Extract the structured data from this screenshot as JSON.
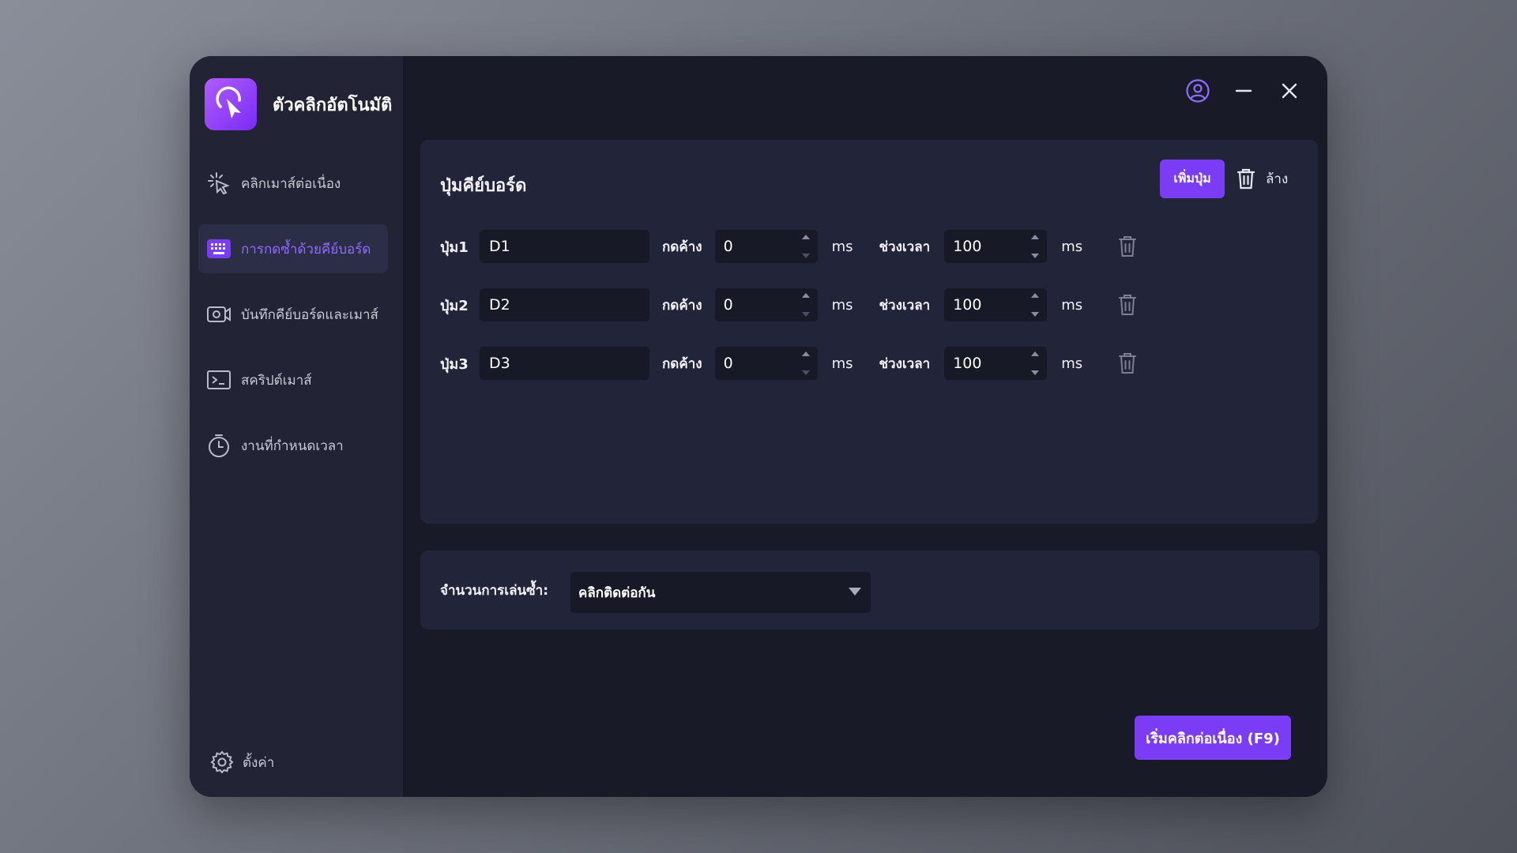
{
  "app": {
    "title": "ตัวคลิกอัตโนมัติ",
    "accent_color": "#7a3cf4"
  },
  "sidebar": {
    "items": [
      {
        "label": "คลิกเมาส์ต่อเนื่อง",
        "icon": "click-burst-icon",
        "active": false
      },
      {
        "label": "การกดซ้ำด้วยคีย์บอร์ด",
        "icon": "keyboard-icon",
        "active": true
      },
      {
        "label": "บันทึกคีย์บอร์ดและเมาส์",
        "icon": "record-camera-icon",
        "active": false
      },
      {
        "label": "สคริปต์เมาส์",
        "icon": "terminal-icon",
        "active": false
      },
      {
        "label": "งานที่กำหนดเวลา",
        "icon": "timer-icon",
        "active": false
      }
    ],
    "settings_label": "ตั้งค่า"
  },
  "header": {
    "icons": [
      "user-circle-icon",
      "minimize-icon",
      "close-icon"
    ]
  },
  "keyboard_panel": {
    "title": "ปุ่มคีย์บอร์ด",
    "add_button": "เพิ่มปุ่ม",
    "clear_button": "ล้าง",
    "hold_label": "กดค้าง",
    "interval_label": "ช่วงเวลา",
    "unit": "ms",
    "rows": [
      {
        "label": "ปุ่ม1",
        "key": "D1",
        "hold": "0",
        "interval": "100"
      },
      {
        "label": "ปุ่ม2",
        "key": "D2",
        "hold": "0",
        "interval": "100"
      },
      {
        "label": "ปุ่ม3",
        "key": "D3",
        "hold": "0",
        "interval": "100"
      }
    ]
  },
  "repeat": {
    "label": "จำนวนการเล่นซ้ำ:",
    "selected": "คลิกติดต่อกัน"
  },
  "start_button": "เริ่มคลิกต่อเนื่อง (F9)"
}
